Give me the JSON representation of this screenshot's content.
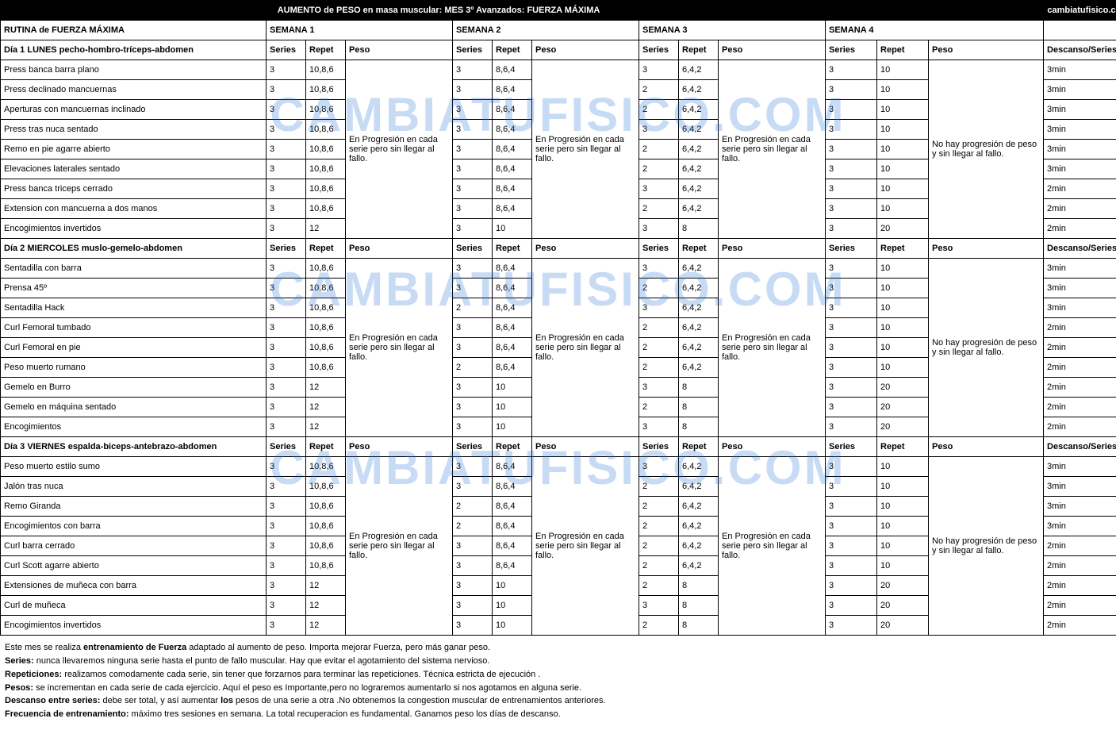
{
  "title_main": "AUMENTO de PESO en masa muscular: MES 3º Avanzados: FUERZA MÁXIMA",
  "title_site": "cambiatufisico.com",
  "watermark": "CAMBIATUFISICO.COM",
  "header": {
    "rutina": "RUTINA de FUERZA MÁXIMA",
    "sem": [
      "SEMANA 1",
      "SEMANA 2",
      "SEMANA 3",
      "SEMANA 4"
    ]
  },
  "cols": {
    "series": "Series",
    "repet": "Repet",
    "peso": "Peso",
    "desc": "Descanso/Series"
  },
  "peso_note_prog": "En Progresión en cada serie pero sin llegar al fallo.",
  "peso_note_prog3": "En Progresión en cada serie pero sin llegar al fallo.",
  "peso_note_noprog": "No hay progresión de peso y sin llegar al fallo.",
  "days": [
    {
      "title": "Día 1 LUNES pecho-hombro-tríceps-abdomen",
      "rows": [
        {
          "ex": "Press banca barra plano",
          "w": [
            [
              "3",
              "10,8,6"
            ],
            [
              "3",
              "8,6,4"
            ],
            [
              "3",
              "6,4,2"
            ],
            [
              "3",
              "10"
            ]
          ],
          "d": "3min"
        },
        {
          "ex": "Press declinado mancuernas",
          "w": [
            [
              "3",
              "10,8,6"
            ],
            [
              "3",
              "8,6,4"
            ],
            [
              "2",
              "6,4,2"
            ],
            [
              "3",
              "10"
            ]
          ],
          "d": "3min"
        },
        {
          "ex": "Aperturas con mancuernas inclinado",
          "w": [
            [
              "3",
              "10,8,6"
            ],
            [
              "3",
              "8,6,4"
            ],
            [
              "2",
              "6,4,2"
            ],
            [
              "3",
              "10"
            ]
          ],
          "d": "3min"
        },
        {
          "ex": "Press tras nuca sentado",
          "w": [
            [
              "3",
              "10,8,6"
            ],
            [
              "3",
              "8,6,4"
            ],
            [
              "3",
              "6,4,2"
            ],
            [
              "3",
              "10"
            ]
          ],
          "d": "3min"
        },
        {
          "ex": "Remo en pie agarre abierto",
          "w": [
            [
              "3",
              "10,8,6"
            ],
            [
              "3",
              "8,6,4"
            ],
            [
              "2",
              "6,4,2"
            ],
            [
              "3",
              "10"
            ]
          ],
          "d": "3min"
        },
        {
          "ex": "Elevaciones laterales sentado",
          "w": [
            [
              "3",
              "10,8,6"
            ],
            [
              "3",
              "8,6,4"
            ],
            [
              "2",
              "6,4,2"
            ],
            [
              "3",
              "10"
            ]
          ],
          "d": "3min"
        },
        {
          "ex": "Press banca triceps cerrado",
          "w": [
            [
              "3",
              "10,8,6"
            ],
            [
              "3",
              "8,6,4"
            ],
            [
              "3",
              "6,4,2"
            ],
            [
              "3",
              "10"
            ]
          ],
          "d": "2min"
        },
        {
          "ex": "Extension con mancuerna a dos manos",
          "w": [
            [
              "3",
              "10,8,6"
            ],
            [
              "3",
              "8,6,4"
            ],
            [
              "2",
              "6,4,2"
            ],
            [
              "3",
              "10"
            ]
          ],
          "d": "2min"
        },
        {
          "ex": "Encogimientos invertidos",
          "w": [
            [
              "3",
              "12"
            ],
            [
              "3",
              "10"
            ],
            [
              "3",
              "8"
            ],
            [
              "3",
              "20"
            ]
          ],
          "d": "2min"
        }
      ]
    },
    {
      "title": "Día 2 MIERCOLES muslo-gemelo-abdomen",
      "rows": [
        {
          "ex": "Sentadilla con barra",
          "w": [
            [
              "3",
              "10,8,6"
            ],
            [
              "3",
              "8,6,4"
            ],
            [
              "3",
              "6,4,2"
            ],
            [
              "3",
              "10"
            ]
          ],
          "d": "3min"
        },
        {
          "ex": "Prensa 45º",
          "w": [
            [
              "3",
              "10,8,6"
            ],
            [
              "3",
              "8,6,4"
            ],
            [
              "2",
              "6,4,2"
            ],
            [
              "3",
              "10"
            ]
          ],
          "d": "3min"
        },
        {
          "ex": "Sentadilla Hack",
          "w": [
            [
              "3",
              "10,8,6"
            ],
            [
              "2",
              "8,6,4"
            ],
            [
              "3",
              "6,4,2"
            ],
            [
              "3",
              "10"
            ]
          ],
          "d": "3min"
        },
        {
          "ex": "Curl Femoral tumbado",
          "w": [
            [
              "3",
              "10,8,6"
            ],
            [
              "3",
              "8,6,4"
            ],
            [
              "2",
              "6,4,2"
            ],
            [
              "3",
              "10"
            ]
          ],
          "d": "2min"
        },
        {
          "ex": "Curl Femoral en pie",
          "w": [
            [
              "3",
              "10,8,6"
            ],
            [
              "3",
              "8,6,4"
            ],
            [
              "2",
              "6,4,2"
            ],
            [
              "3",
              "10"
            ]
          ],
          "d": "2min"
        },
        {
          "ex": "Peso muerto rumano",
          "w": [
            [
              "3",
              "10,8,6"
            ],
            [
              "2",
              "8,6,4"
            ],
            [
              "2",
              "6,4,2"
            ],
            [
              "3",
              "10"
            ]
          ],
          "d": "2min"
        },
        {
          "ex": "Gemelo en Burro",
          "w": [
            [
              "3",
              "12"
            ],
            [
              "3",
              "10"
            ],
            [
              "3",
              "8"
            ],
            [
              "3",
              "20"
            ]
          ],
          "d": "2min"
        },
        {
          "ex": "Gemelo en máquina sentado",
          "w": [
            [
              "3",
              "12"
            ],
            [
              "3",
              "10"
            ],
            [
              "2",
              "8"
            ],
            [
              "3",
              "20"
            ]
          ],
          "d": "2min"
        },
        {
          "ex": "Encogimientos",
          "w": [
            [
              "3",
              "12"
            ],
            [
              "3",
              "10"
            ],
            [
              "3",
              "8"
            ],
            [
              "3",
              "20"
            ]
          ],
          "d": "2min"
        }
      ]
    },
    {
      "title": "Día 3 VIERNES espalda-biceps-antebrazo-abdomen",
      "rows": [
        {
          "ex": "Peso muerto estilo sumo",
          "w": [
            [
              "3",
              "10,8,6"
            ],
            [
              "3",
              "8,6,4"
            ],
            [
              "3",
              "6,4,2"
            ],
            [
              "3",
              "10"
            ]
          ],
          "d": "3min"
        },
        {
          "ex": "Jalón tras nuca",
          "w": [
            [
              "3",
              "10,8,6"
            ],
            [
              "3",
              "8,6,4"
            ],
            [
              "2",
              "6,4,2"
            ],
            [
              "3",
              "10"
            ]
          ],
          "d": "3min"
        },
        {
          "ex": "Remo Giranda",
          "w": [
            [
              "3",
              "10,8,6"
            ],
            [
              "2",
              "8,6,4"
            ],
            [
              "2",
              "6,4,2"
            ],
            [
              "3",
              "10"
            ]
          ],
          "d": "3min"
        },
        {
          "ex": "Encogimientos con barra",
          "w": [
            [
              "3",
              "10,8,6"
            ],
            [
              "2",
              "8,6,4"
            ],
            [
              "2",
              "6,4,2"
            ],
            [
              "3",
              "10"
            ]
          ],
          "d": "3min"
        },
        {
          "ex": "Curl barra cerrado",
          "w": [
            [
              "3",
              "10,8,6"
            ],
            [
              "3",
              "8,6,4"
            ],
            [
              "2",
              "6,4,2"
            ],
            [
              "3",
              "10"
            ]
          ],
          "d": "2min"
        },
        {
          "ex": "Curl Scott agarre abierto",
          "w": [
            [
              "3",
              "10,8,6"
            ],
            [
              "3",
              "8,6,4"
            ],
            [
              "2",
              "6,4,2"
            ],
            [
              "3",
              "10"
            ]
          ],
          "d": "2min"
        },
        {
          "ex": "Extensiones de muñeca con barra",
          "w": [
            [
              "3",
              "12"
            ],
            [
              "3",
              "10"
            ],
            [
              "2",
              "8"
            ],
            [
              "3",
              "20"
            ]
          ],
          "d": "2min"
        },
        {
          "ex": "Curl de muñeca",
          "w": [
            [
              "3",
              "12"
            ],
            [
              "3",
              "10"
            ],
            [
              "3",
              "8"
            ],
            [
              "3",
              "20"
            ]
          ],
          "d": "2min"
        },
        {
          "ex": "Encogimientos invertidos",
          "w": [
            [
              "3",
              "12"
            ],
            [
              "3",
              "10"
            ],
            [
              "2",
              "8"
            ],
            [
              "3",
              "20"
            ]
          ],
          "d": "2min"
        }
      ]
    }
  ],
  "notes": [
    {
      "b": "",
      "t": "Este mes se realiza <b>entrenamiento de Fuerza</b> adaptado al aumento de peso. Importa mejorar Fuerza, pero más ganar peso."
    },
    {
      "b": "Series:",
      "t": " nunca llevaremos ninguna serie hasta el punto de fallo muscular. Hay que evitar el agotamiento del sistema nervioso."
    },
    {
      "b": "Repeticiones:",
      "t": " realizamos comodamente cada serie, sin tener que forzarnos para terminar las repeticiones. Técnica estricta de ejecución ."
    },
    {
      "b": "Pesos:",
      "t": " se incrementan en cada serie de cada ejercicio. Aquí el peso es Importante,pero no lograremos aumentarlo si nos agotamos en alguna serie."
    },
    {
      "b": "Descanso entre series:",
      "t": " debe ser total, y así aumentar  <b>los</b>  pesos de una serie a otra .No obtenemos la congestion muscular de entrenamientos anteriores."
    },
    {
      "b": "Frecuencia de entrenamiento:",
      "t": " máximo tres sesiones en semana. La total recuperacion es fundamental. Ganamos peso los días de descanso."
    }
  ]
}
